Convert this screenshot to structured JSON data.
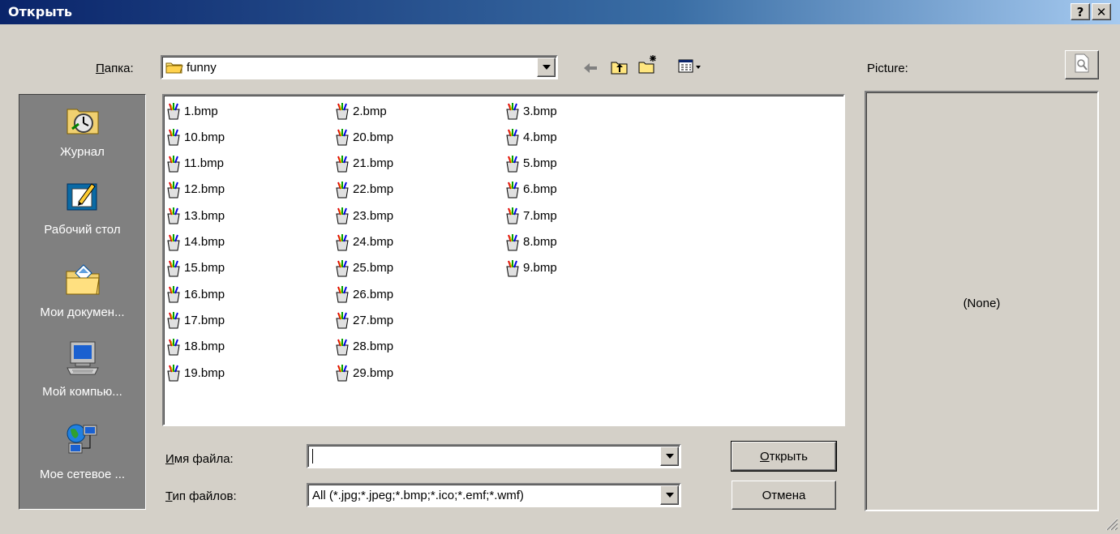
{
  "window": {
    "title": "Открыть",
    "help_label": "?",
    "close_label": "✕"
  },
  "lookin": {
    "label_accel": "П",
    "label_rest": "апка:",
    "folder": "funny"
  },
  "toolbar": {
    "back_icon": "back-arrow-icon",
    "up_icon": "up-folder-icon",
    "newfolder_icon": "new-folder-icon",
    "view_icon": "view-menu-icon"
  },
  "places": [
    {
      "label": "Журнал",
      "icon": "history-icon"
    },
    {
      "label": "Рабочий стол",
      "icon": "desktop-icon"
    },
    {
      "label": "Мои докумен...",
      "icon": "my-documents-icon"
    },
    {
      "label": "Мой компью...",
      "icon": "my-computer-icon"
    },
    {
      "label": "Мое сетевое ...",
      "icon": "network-icon"
    }
  ],
  "files": {
    "col1": [
      "1.bmp",
      "10.bmp",
      "11.bmp",
      "12.bmp",
      "13.bmp",
      "14.bmp",
      "15.bmp",
      "16.bmp",
      "17.bmp",
      "18.bmp",
      "19.bmp"
    ],
    "col2": [
      "2.bmp",
      "20.bmp",
      "21.bmp",
      "22.bmp",
      "23.bmp",
      "24.bmp",
      "25.bmp",
      "26.bmp",
      "27.bmp",
      "28.bmp",
      "29.bmp"
    ],
    "col3": [
      "3.bmp",
      "4.bmp",
      "5.bmp",
      "6.bmp",
      "7.bmp",
      "8.bmp",
      "9.bmp"
    ]
  },
  "filename": {
    "label_accel": "И",
    "label_rest": "мя файла:",
    "value": ""
  },
  "filetype": {
    "label_accel": "Т",
    "label_rest": "ип файлов:",
    "value": "All (*.jpg;*.jpeg;*.bmp;*.ico;*.emf;*.wmf)"
  },
  "buttons": {
    "open_accel": "О",
    "open_rest": "ткрыть",
    "cancel": "Отмена"
  },
  "preview": {
    "label": "Picture:",
    "none_text": "(None)"
  }
}
